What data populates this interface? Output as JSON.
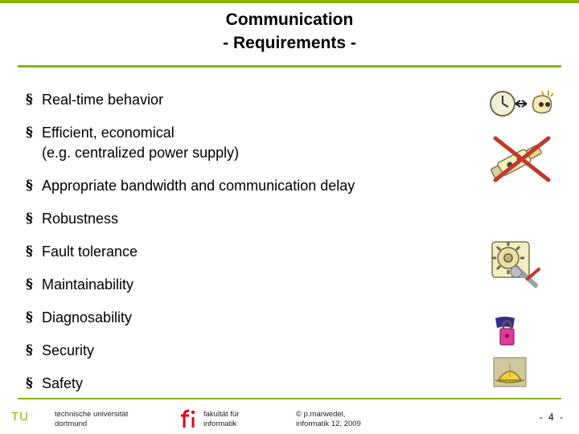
{
  "slide": {
    "title_line1": "Communication",
    "title_line2": "- Requirements -",
    "bullet_mark": "§",
    "bullets": [
      {
        "text": "Real-time behavior",
        "sub": ""
      },
      {
        "text": "Efficient, economical",
        "sub": "(e.g. centralized power supply)"
      },
      {
        "text": "Appropriate bandwidth and communication delay",
        "sub": ""
      },
      {
        "text": "Robustness",
        "sub": ""
      },
      {
        "text": "Fault tolerance",
        "sub": ""
      },
      {
        "text": "Maintainability",
        "sub": ""
      },
      {
        "text": "Diagnosability",
        "sub": ""
      },
      {
        "text": "Security",
        "sub": ""
      },
      {
        "text": "Safety",
        "sub": ""
      }
    ]
  },
  "footer": {
    "logo_tu": "TU",
    "university_line1": "technische universität",
    "university_line2": "dortmund",
    "faculty_line1": "fakultät für",
    "faculty_line2": "informatik",
    "copyright_line1": "© p.marwedel,",
    "copyright_line2": "informatik 12,  2009",
    "page_number": "-  4  -"
  },
  "graphics": {
    "clock_icon": "clock-timing-icon",
    "power_icon": "power-plug-crossed-icon",
    "gear_icon": "gears-maintenance-icon",
    "lock_icon": "padlock-security-icon",
    "hat_icon": "safety-helmet-icon"
  },
  "colors": {
    "accent": "#8CB400",
    "text": "#000000",
    "cross": "#C0392B"
  }
}
